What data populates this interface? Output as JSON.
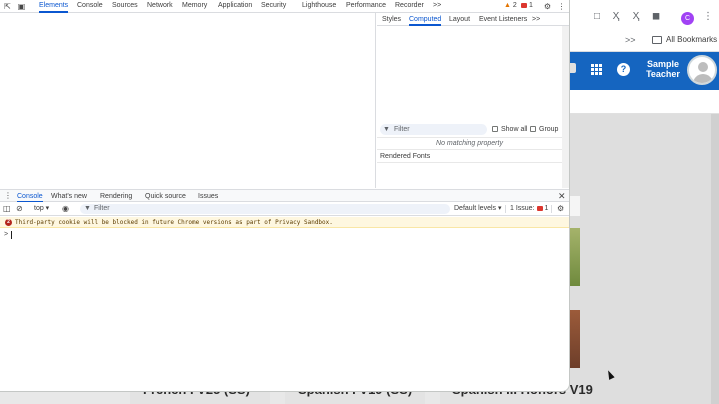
{
  "devtools": {
    "main_tabs": [
      {
        "label": "Elements",
        "active": true
      },
      {
        "label": "Console",
        "active": false
      },
      {
        "label": "Sources",
        "active": false
      },
      {
        "label": "Network",
        "active": false
      },
      {
        "label": "Memory",
        "active": false
      },
      {
        "label": "Application",
        "active": false
      },
      {
        "label": "Security",
        "active": false
      },
      {
        "label": "Lighthouse",
        "active": false
      },
      {
        "label": "Performance",
        "active": false
      },
      {
        "label": "Recorder",
        "active": false
      }
    ],
    "more_tabs_glyph": ">>",
    "warning_count": "2",
    "error_count": "1",
    "styles_tabs": [
      {
        "label": "Styles",
        "active": false
      },
      {
        "label": "Computed",
        "active": true
      },
      {
        "label": "Layout",
        "active": false
      },
      {
        "label": "Event Listeners",
        "active": false
      }
    ],
    "styles_more_glyph": ">>",
    "computed": {
      "filter_placeholder": "Filter",
      "show_all_label": "Show all",
      "group_label": "Group",
      "no_match_text": "No matching property",
      "rendered_fonts_label": "Rendered Fonts"
    },
    "drawer_tabs": [
      {
        "label": "Console",
        "active": true
      },
      {
        "label": "What's new",
        "active": false
      },
      {
        "label": "Rendering",
        "active": false
      },
      {
        "label": "Quick source",
        "active": false
      },
      {
        "label": "Issues",
        "active": false
      }
    ],
    "console": {
      "context": "top",
      "filter_placeholder": "Filter",
      "levels_label": "Default levels",
      "issues_label": "1 Issue:",
      "issues_count": "1",
      "messages": [
        {
          "level": "warning",
          "count": "2",
          "text": "Third-party cookie will be blocked in future Chrome versions as part of Privacy Sandbox."
        }
      ],
      "prompt_glyph": ">"
    }
  },
  "browser": {
    "profile_initial": "C",
    "bookmarks_chevron": ">>",
    "bookmarks_label": "All Bookmarks"
  },
  "page": {
    "help_glyph": "?",
    "user_line1": "Sample",
    "user_line2": "Teacher",
    "course_titles": [
      "French I V25 (SS)",
      "Spanish I V19 (SS)",
      "Spanish III Honors V19"
    ]
  },
  "colors": {
    "accent": "#0b57d0",
    "header_blue": "#1565c0",
    "warning_bg": "#fef7e0",
    "error_red": "#dc362e"
  }
}
